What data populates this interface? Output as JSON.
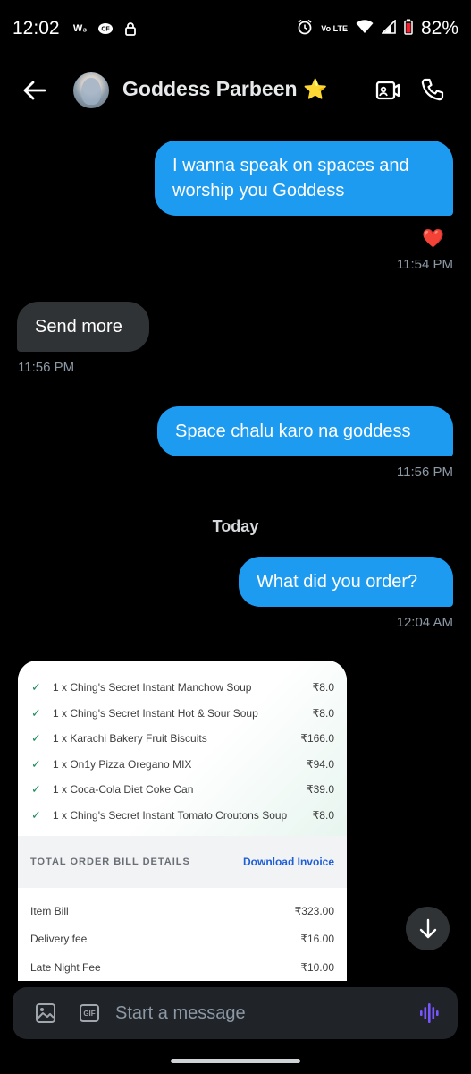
{
  "status_bar": {
    "time": "12:02",
    "left_icons": [
      "w-icon",
      "cf-icon",
      "lock-icon"
    ],
    "battery": "82%",
    "network_label": "Vo LTE"
  },
  "header": {
    "contact_name": "Goddess Parbeen",
    "name_emoji": "⭐"
  },
  "messages": [
    {
      "direction": "out",
      "text": "I wanna speak on spaces and worship you Goddess",
      "reaction": "❤️",
      "time": "11:54 PM"
    },
    {
      "direction": "in",
      "text": "Send more",
      "time": "11:56 PM"
    },
    {
      "direction": "out",
      "text": "Space chalu karo na goddess",
      "time": "11:56 PM"
    },
    {
      "direction": "out",
      "text": "What did you order?",
      "time": "12:04 AM"
    }
  ],
  "day_separator": "Today",
  "order": {
    "items": [
      {
        "name": "1 x Ching's Secret Instant Manchow Soup",
        "price": "₹8.0"
      },
      {
        "name": "1 x Ching's Secret Instant Hot & Sour Soup",
        "price": "₹8.0"
      },
      {
        "name": "1 x Karachi Bakery Fruit Biscuits",
        "price": "₹166.0"
      },
      {
        "name": "1 x On1y Pizza Oregano MIX",
        "price": "₹94.0"
      },
      {
        "name": "1 x Coca-Cola Diet Coke Can",
        "price": "₹39.0"
      },
      {
        "name": "1 x Ching's Secret Instant Tomato Croutons Soup",
        "price": "₹8.0"
      }
    ],
    "bill_title": "TOTAL ORDER BILL DETAILS",
    "download_label": "Download Invoice",
    "bill_rows": [
      {
        "label": "Item Bill",
        "amount": "₹323.00"
      },
      {
        "label": "Delivery fee",
        "amount": "₹16.00"
      },
      {
        "label": "Late Night Fee",
        "amount": "₹10.00"
      }
    ]
  },
  "composer": {
    "placeholder": "Start a message",
    "gif_label": "GIF"
  },
  "colors": {
    "outgoing_bubble": "#1d9bf0",
    "incoming_bubble": "#2f3336",
    "background": "#000000",
    "voice_accent": "#7856ff"
  }
}
